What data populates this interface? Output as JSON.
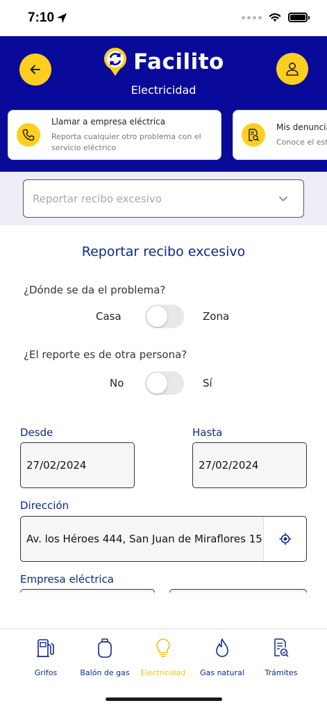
{
  "status_bar": {
    "time": "7:10"
  },
  "header": {
    "brand": "Facilito",
    "subtitle": "Electricidad",
    "cards": [
      {
        "title": "Llamar a empresa eléctrica",
        "desc_line1": "Reporta cualquier otro problema con el",
        "desc_line2": "servicio eléctrico"
      },
      {
        "title": "Mis denuncias",
        "desc_line1": "Conoce el estado",
        "desc_line2": ""
      }
    ]
  },
  "report_type": {
    "selected": "Reportar recibo excesivo"
  },
  "form": {
    "title": "Reportar recibo excesivo",
    "q_location": "¿Dónde se da el problema?",
    "loc_left": "Casa",
    "loc_right": "Zona",
    "q_other": "¿El reporte es de otra persona?",
    "other_left": "No",
    "other_right": "Sí",
    "desde_label": "Desde",
    "desde_value": "27/02/2024",
    "hasta_label": "Hasta",
    "hasta_value": "27/02/2024",
    "direccion_label": "Dirección",
    "direccion_value": "Av. los Héroes 444, San Juan de Miraflores 15",
    "empresa_label": "Empresa eléctrica"
  },
  "bottom_nav": [
    {
      "label": "Grifos",
      "icon": "gas-pump-icon"
    },
    {
      "label": "Balón de gas",
      "icon": "gas-cylinder-icon"
    },
    {
      "label": "Electricidad",
      "icon": "lightbulb-icon",
      "active": true
    },
    {
      "label": "Gas natural",
      "icon": "flame-icon"
    },
    {
      "label": "Trámites",
      "icon": "document-check-icon"
    }
  ],
  "colors": {
    "primary": "#0a0a9a",
    "accent": "#ffcf1f",
    "text_blue": "#0a2a8a"
  }
}
